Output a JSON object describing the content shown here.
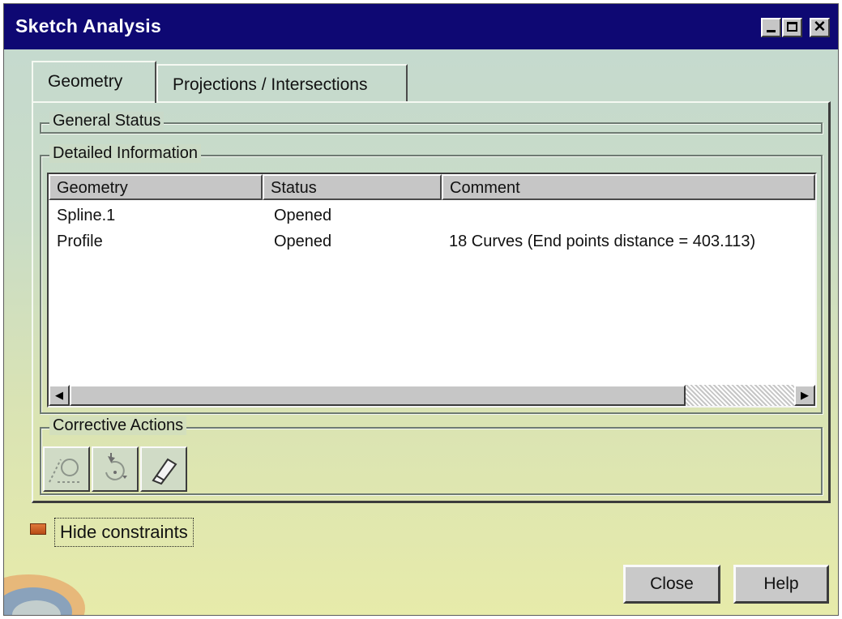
{
  "window": {
    "title": "Sketch Analysis"
  },
  "tabs": [
    {
      "label": "Geometry",
      "active": true
    },
    {
      "label": "Projections / Intersections",
      "active": false
    }
  ],
  "groups": {
    "general_status": "General Status",
    "detailed_information": "Detailed Information",
    "corrective_actions": "Corrective Actions"
  },
  "table": {
    "columns": [
      "Geometry",
      "Status",
      "Comment"
    ],
    "rows": [
      {
        "geometry": "Spline.1",
        "status": "Opened",
        "comment": ""
      },
      {
        "geometry": "Profile",
        "status": "Opened",
        "comment": "18 Curves (End points distance = 403.113)"
      }
    ]
  },
  "corrective_icons": [
    "point-circle-icon",
    "rotate-point-icon",
    "eraser-icon"
  ],
  "options": {
    "hide_constraints_label": "Hide constraints"
  },
  "buttons": {
    "close": "Close",
    "help": "Help"
  },
  "colors": {
    "titlebar": "#0e0873",
    "check_indicator": "#d0652a"
  }
}
